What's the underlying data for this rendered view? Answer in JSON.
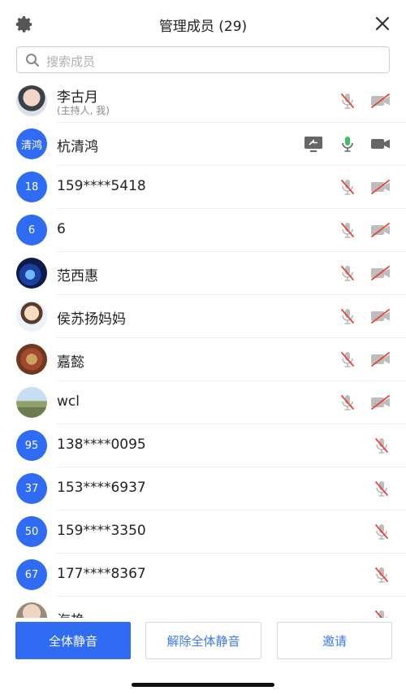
{
  "header": {
    "title": "管理成员 (29)",
    "settings_icon": "gear-icon",
    "close_icon": "close-icon"
  },
  "search": {
    "placeholder": "搜索成员",
    "icon": "search-icon"
  },
  "members": [
    {
      "name": "李古月",
      "subtitle": "(主持人, 我)",
      "avatar_text": "",
      "avatar_style": "img1",
      "mic": "muted",
      "camera": "off",
      "sharing": false
    },
    {
      "name": "杭清鸿",
      "subtitle": "",
      "avatar_text": "清鸿",
      "avatar_style": "",
      "mic": "on",
      "camera": "on",
      "sharing": true
    },
    {
      "name": "159****5418",
      "subtitle": "",
      "avatar_text": "18",
      "avatar_style": "",
      "mic": "muted",
      "camera": "off",
      "sharing": false
    },
    {
      "name": "6",
      "subtitle": "",
      "avatar_text": "6",
      "avatar_style": "",
      "mic": "muted",
      "camera": "off",
      "sharing": false
    },
    {
      "name": "范西惠",
      "subtitle": "",
      "avatar_text": "",
      "avatar_style": "img2",
      "mic": "muted",
      "camera": "off",
      "sharing": false
    },
    {
      "name": "侯苏扬妈妈",
      "subtitle": "",
      "avatar_text": "",
      "avatar_style": "img3",
      "mic": "muted",
      "camera": "off",
      "sharing": false
    },
    {
      "name": "嘉懿",
      "subtitle": "",
      "avatar_text": "",
      "avatar_style": "img4",
      "mic": "muted",
      "camera": "off",
      "sharing": false
    },
    {
      "name": "wcl",
      "subtitle": "",
      "avatar_text": "",
      "avatar_style": "img5",
      "mic": "muted",
      "camera": "off",
      "sharing": false
    },
    {
      "name": "138****0095",
      "subtitle": "",
      "avatar_text": "95",
      "avatar_style": "",
      "mic": "muted",
      "camera": "none",
      "sharing": false
    },
    {
      "name": "153****6937",
      "subtitle": "",
      "avatar_text": "37",
      "avatar_style": "",
      "mic": "muted",
      "camera": "none",
      "sharing": false
    },
    {
      "name": "159****3350",
      "subtitle": "",
      "avatar_text": "50",
      "avatar_style": "",
      "mic": "muted",
      "camera": "none",
      "sharing": false
    },
    {
      "name": "177****8367",
      "subtitle": "",
      "avatar_text": "67",
      "avatar_style": "",
      "mic": "muted",
      "camera": "none",
      "sharing": false
    },
    {
      "name": "海艳",
      "subtitle": "",
      "avatar_text": "",
      "avatar_style": "img6",
      "mic": "muted",
      "camera": "none",
      "sharing": false
    }
  ],
  "actions": {
    "mute_all": "全体静音",
    "unmute_all": "解除全体静音",
    "invite": "邀请"
  },
  "colors": {
    "accent": "#2f6cf3",
    "muted_red": "#e5473b",
    "mic_on_green": "#3cc35d",
    "icon_gray": "#666666"
  }
}
